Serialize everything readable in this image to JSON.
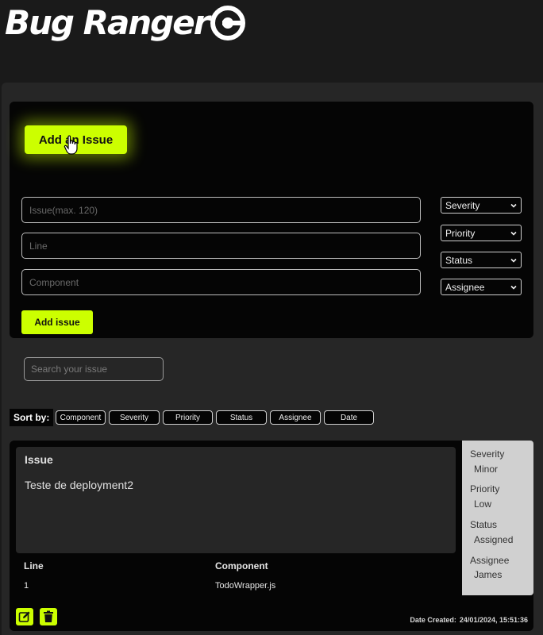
{
  "app": {
    "title": "Bug Ranger"
  },
  "form": {
    "open_button_label": "Add an Issue",
    "issue_placeholder": "Issue(max. 120)",
    "line_placeholder": "Line",
    "component_placeholder": "Component",
    "selects": [
      "Severity",
      "Priority",
      "Status",
      "Assignee"
    ],
    "submit_label": "Add issue"
  },
  "search": {
    "placeholder": "Search your issue"
  },
  "sort": {
    "label": "Sort by:",
    "options": [
      "Component",
      "Severity",
      "Priority",
      "Status",
      "Assignee",
      "Date"
    ]
  },
  "issue": {
    "heading": "Issue",
    "text": "Teste de deployment2",
    "line_header": "Line",
    "line_value": "1",
    "component_header": "Component",
    "component_value": "TodoWrapper.js",
    "date_label": "Date Created:",
    "date_value": "24/01/2024, 15:51:36",
    "meta": [
      {
        "label": "Severity",
        "value": "Minor"
      },
      {
        "label": "Priority",
        "value": "Low"
      },
      {
        "label": "Status",
        "value": "Assigned"
      },
      {
        "label": "Assignee",
        "value": "James"
      }
    ]
  },
  "colors": {
    "accent": "#ccff00",
    "background": "#1a1a1a",
    "card": "#050505"
  }
}
